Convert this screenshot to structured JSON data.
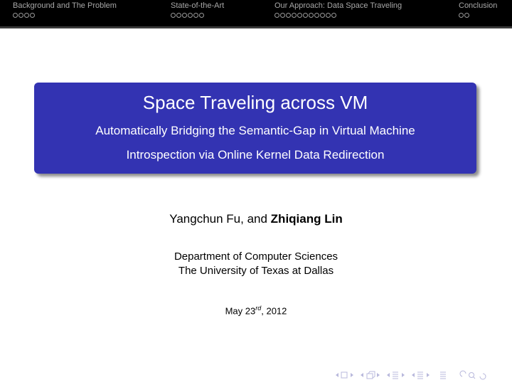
{
  "header": {
    "sections": [
      {
        "label": "Background and The Problem",
        "frames": 4
      },
      {
        "label": "State-of-the-Art",
        "frames": 6
      },
      {
        "label": "Our Approach: Data Space Traveling",
        "frames": 11
      },
      {
        "label": "Conclusion",
        "frames": 2
      }
    ]
  },
  "title_block": {
    "title": "Space Traveling across VM",
    "subtitle_line1": "Automatically Bridging the Semantic-Gap in Virtual Machine",
    "subtitle_line2": "Introspection via Online Kernel Data Redirection"
  },
  "authors": {
    "regular": "Yangchun Fu, and ",
    "bold": "Zhiqiang Lin"
  },
  "institute": {
    "line1": "Department of Computer Sciences",
    "line2": "The University of Texas at Dallas"
  },
  "date": {
    "prefix": "May 23",
    "superscript": "rd",
    "suffix": ", 2012"
  },
  "navigation": {
    "icons": [
      "frame-nav-icon",
      "subsection-nav-icon",
      "section-nav-icon",
      "document-nav-icon",
      "appendix-icon",
      "search-icon"
    ],
    "color": "#b8b8dc"
  },
  "colors": {
    "title_box": "#3333b2",
    "header_bg": "#000000",
    "header_text": "#a8a8a8"
  }
}
